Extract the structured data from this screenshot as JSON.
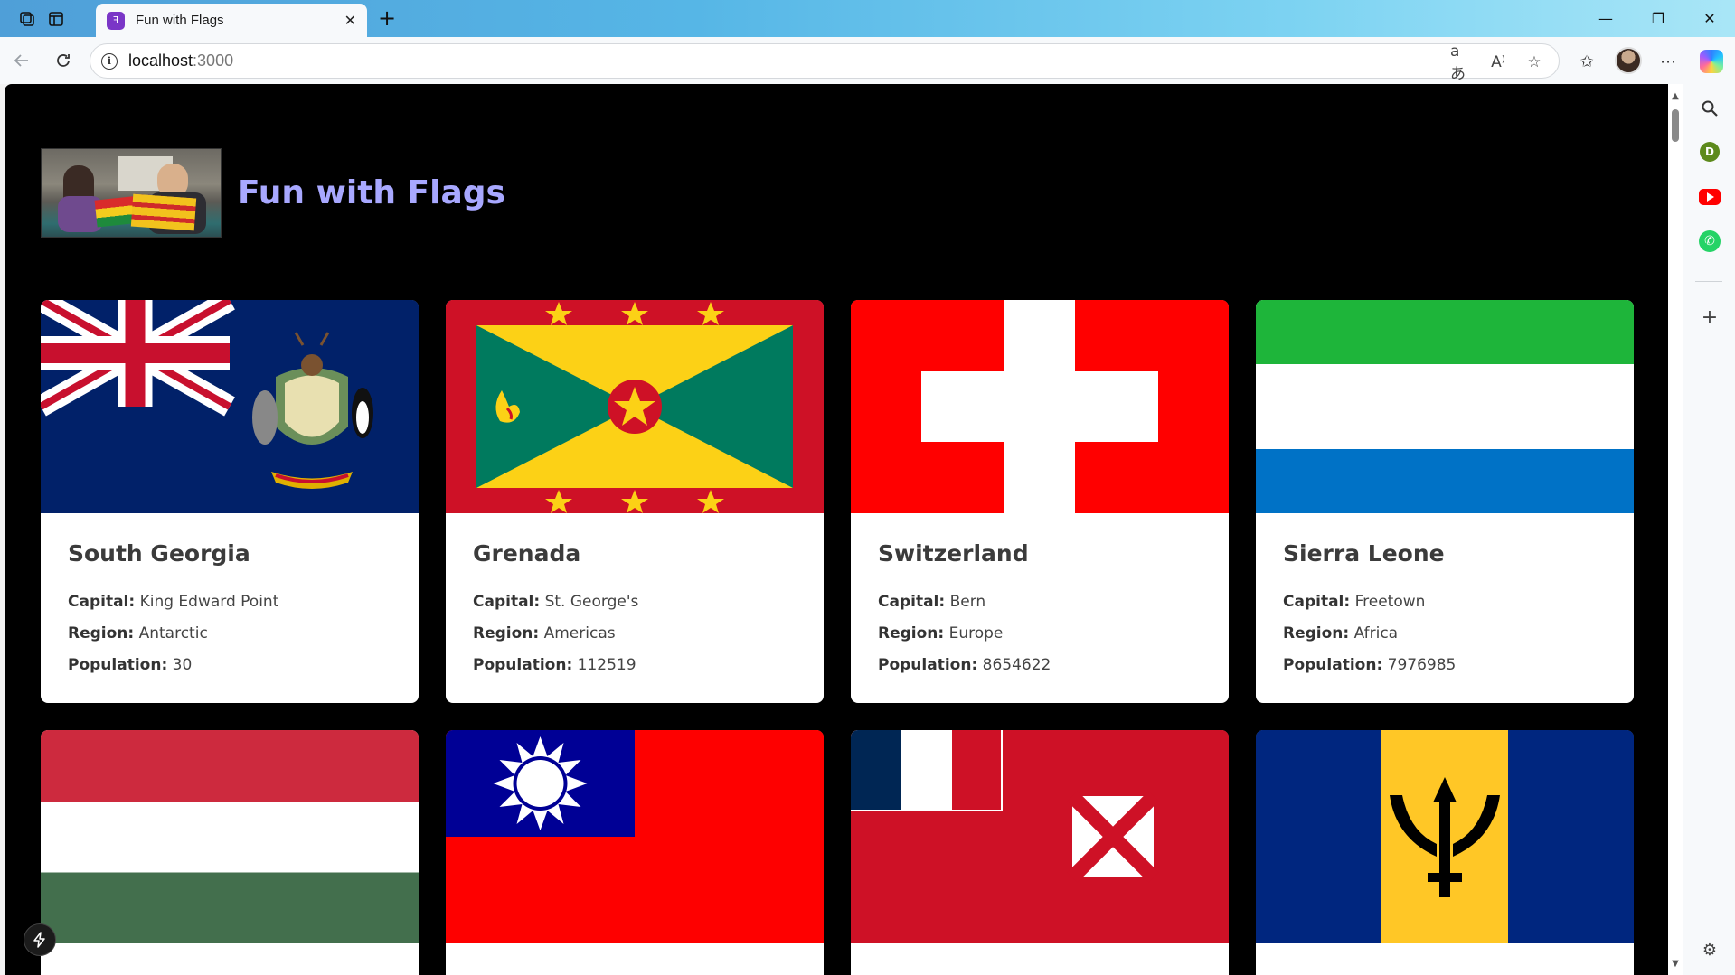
{
  "browser": {
    "tab_title": "Fun with Flags",
    "tab_close": "✕",
    "new_tab": "+",
    "url_host": "localhost",
    "url_port": ":3000",
    "window_controls": {
      "minimize": "—",
      "restore": "❐",
      "close": "✕"
    }
  },
  "sidebar": {
    "profile_letter": "D"
  },
  "site": {
    "title": "Fun with Flags"
  },
  "labels": {
    "capital": "Capital:",
    "region": "Region:",
    "population": "Population:"
  },
  "countries": [
    {
      "name": "South Georgia",
      "capital": "King Edward Point",
      "region": "Antarctic",
      "population": "30",
      "flag": "south-georgia"
    },
    {
      "name": "Grenada",
      "capital": "St. George's",
      "region": "Americas",
      "population": "112519",
      "flag": "grenada"
    },
    {
      "name": "Switzerland",
      "capital": "Bern",
      "region": "Europe",
      "population": "8654622",
      "flag": "switzerland"
    },
    {
      "name": "Sierra Leone",
      "capital": "Freetown",
      "region": "Africa",
      "population": "7976985",
      "flag": "sierra-leone"
    },
    {
      "flag": "hungary"
    },
    {
      "flag": "taiwan"
    },
    {
      "flag": "wallis-and-futuna"
    },
    {
      "flag": "barbados"
    }
  ],
  "colors": {
    "page_bg": "#000000",
    "title": "#a8a8ff",
    "card_bg": "#ffffff"
  }
}
